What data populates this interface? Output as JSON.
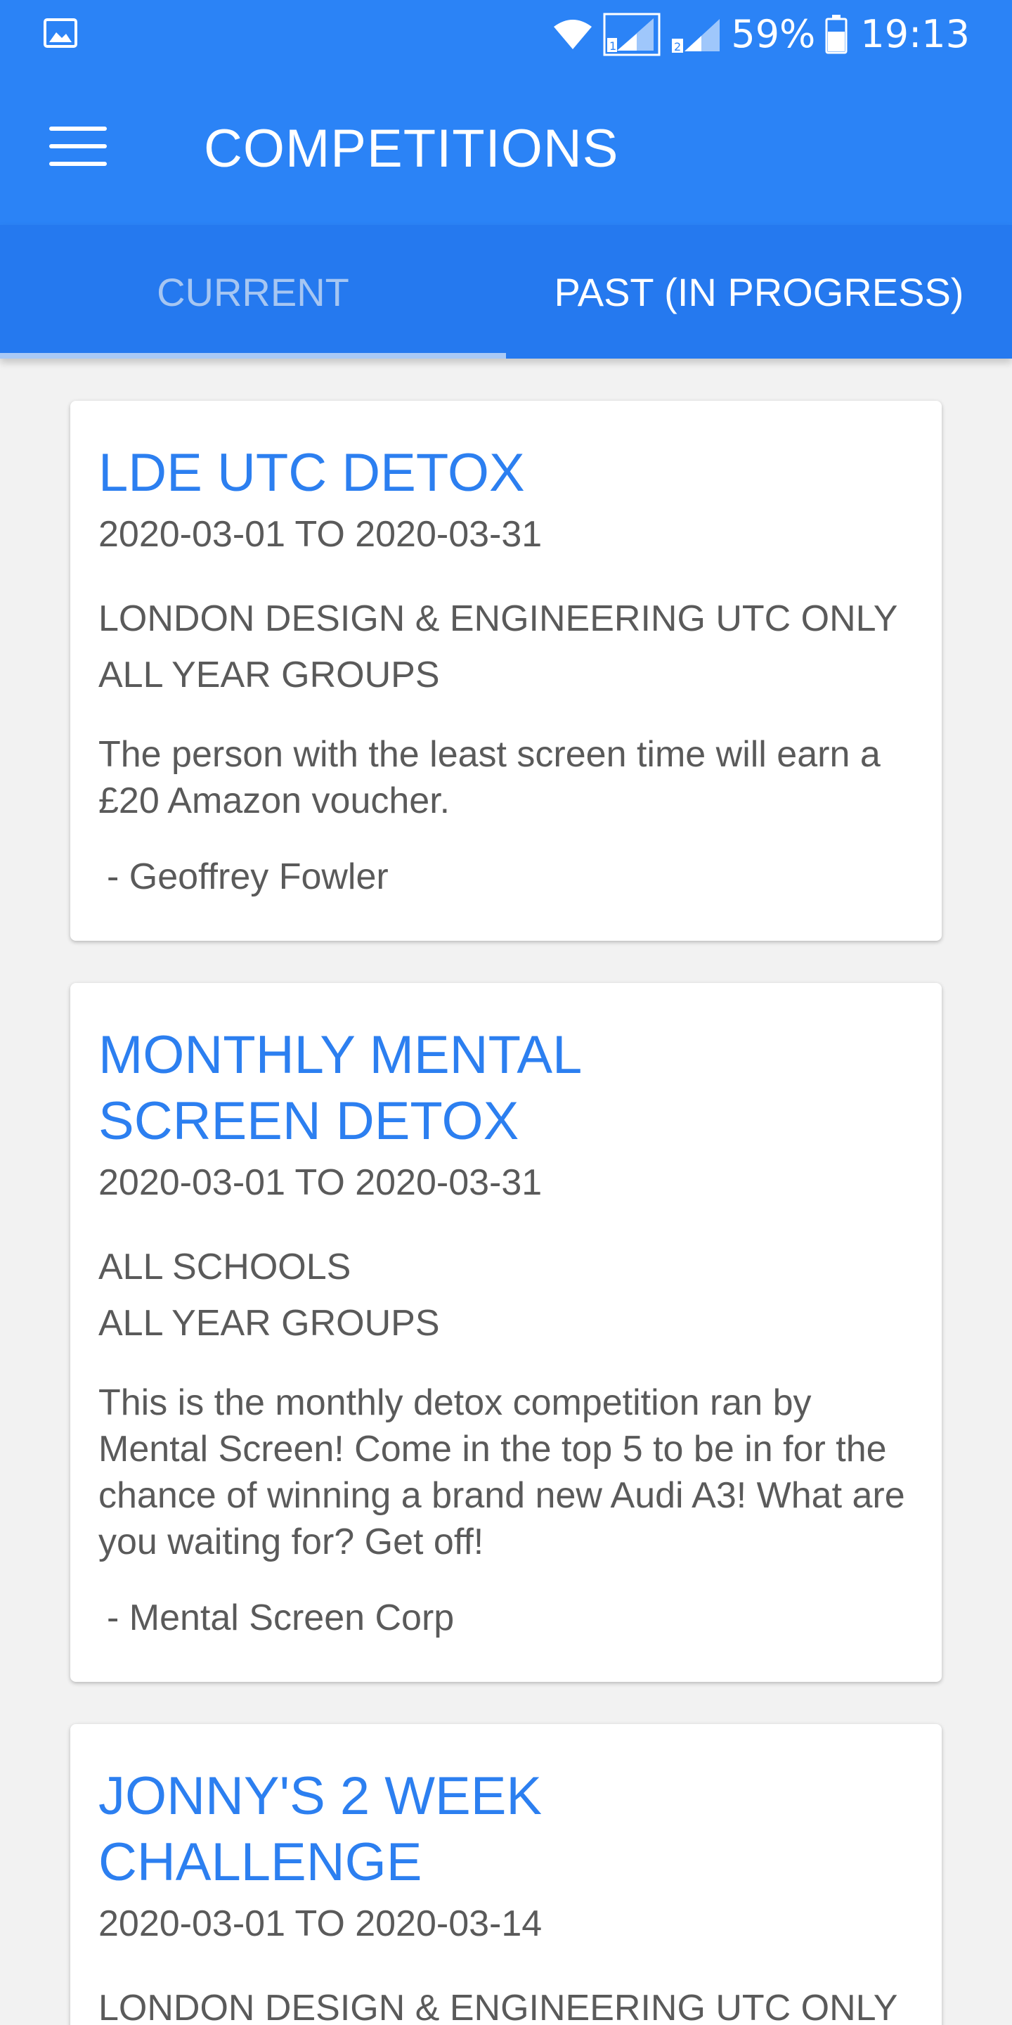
{
  "status_bar": {
    "left_icon": "image-icon",
    "battery_percent": "59%",
    "time": "19:13",
    "sim1_label": "1",
    "sim2_label": "2"
  },
  "app_bar": {
    "menu_icon": "hamburger-menu-icon",
    "title": "COMPETITIONS"
  },
  "tabs": {
    "current_label": "CURRENT",
    "past_label": "PAST (IN PROGRESS)"
  },
  "competitions": [
    {
      "title": "LDE UTC DETOX",
      "dates": "2020-03-01 TO 2020-03-31",
      "school": "LONDON DESIGN & ENGINEERING UTC ONLY",
      "year_groups": "ALL YEAR GROUPS",
      "description": "The person with the least screen time will earn a £20 Amazon voucher.",
      "author": "- Geoffrey Fowler"
    },
    {
      "title": "MONTHLY MENTAL SCREEN DETOX",
      "dates": "2020-03-01 TO 2020-03-31",
      "school": "ALL SCHOOLS",
      "year_groups": "ALL YEAR GROUPS",
      "description": "This is the monthly detox competition ran by Mental Screen! Come in the top 5 to be in for the chance of winning a brand new Audi A3! What are you waiting for? Get off!",
      "author": "- Mental Screen Corp"
    },
    {
      "title": "JONNY'S 2 WEEK CHALLENGE",
      "dates": "2020-03-01 TO 2020-03-14",
      "school": "LONDON DESIGN & ENGINEERING UTC ONLY",
      "year_groups": "",
      "description": "",
      "author": ""
    }
  ],
  "colors": {
    "primary": "#2b83f6",
    "tab_bar": "#2579ef",
    "title_blue": "#2c7ff0",
    "background": "#f2f2f2"
  }
}
